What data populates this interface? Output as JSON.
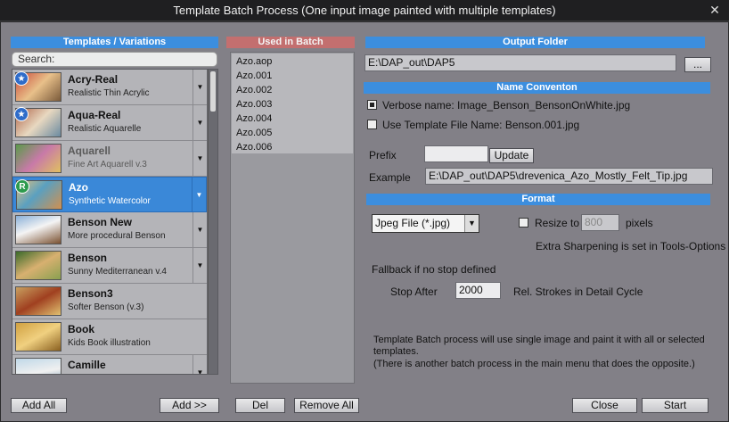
{
  "window": {
    "title": "Template Batch Process (One input image painted with multiple templates)",
    "close_glyph": "✕"
  },
  "templates": {
    "header": "Templates / Variations",
    "search_placeholder": "Search:",
    "items": [
      {
        "name": "Acry-Real",
        "sub": "Realistic Thin Acrylic",
        "badge": "star"
      },
      {
        "name": "Aqua-Real",
        "sub": "Realistic Aquarelle",
        "badge": "star"
      },
      {
        "name": "Aquarell",
        "sub": "Fine Art Aquarell v.3",
        "dim": true
      },
      {
        "name": "Azo",
        "sub": "Synthetic Watercolor",
        "badge": "R",
        "selected": true
      },
      {
        "name": "Benson New",
        "sub": "More procedural Benson"
      },
      {
        "name": "Benson",
        "sub": "Sunny Mediterranean v.4"
      },
      {
        "name": "Benson3",
        "sub": "Softer Benson (v.3)"
      },
      {
        "name": "Book",
        "sub": "Kids Book illustration"
      },
      {
        "name": "Camille",
        "sub": ""
      }
    ]
  },
  "batch": {
    "header": "Used in Batch",
    "items": [
      "Azo.aop",
      "Azo.001",
      "Azo.002",
      "Azo.003",
      "Azo.004",
      "Azo.005",
      "Azo.006"
    ]
  },
  "output": {
    "header": "Output Folder",
    "folder": "E:\\DAP_out\\DAP5",
    "browse": "..."
  },
  "naming": {
    "header": "Name Conventon",
    "verbose_label": "Verbose name:  Image_Benson_BensonOnWhite.jpg",
    "template_label": "Use Template File Name: Benson.001.jpg",
    "prefix_label": "Prefix",
    "prefix_value": "",
    "update": "Update",
    "example_label": "Example",
    "example_value": "E:\\DAP_out\\DAP5\\drevenica_Azo_Mostly_Felt_Tip.jpg"
  },
  "format": {
    "header": "Format",
    "file_type": "Jpeg File (*.jpg)",
    "resize_label": "Resize to",
    "resize_value": "800",
    "resize_unit": "pixels",
    "sharpen_note": "Extra Sharpening is set in Tools-Options",
    "fallback_label": "Fallback if no stop defined",
    "stop_label": "Stop After",
    "stop_value": "2000",
    "stop_unit": "Rel. Strokes in Detail Cycle"
  },
  "info": {
    "line1": "Template Batch process will use single image and paint it with all or selected templates.",
    "line2": "(There is another batch process in the main menu that does the opposite.)"
  },
  "buttons": {
    "add_all": "Add All",
    "add": "Add >>",
    "del": "Del",
    "remove_all": "Remove All",
    "close": "Close",
    "start": "Start"
  },
  "colors": {
    "accent": "#3c8ede",
    "batch_header": "#c36f6f",
    "panel": "#828087"
  }
}
